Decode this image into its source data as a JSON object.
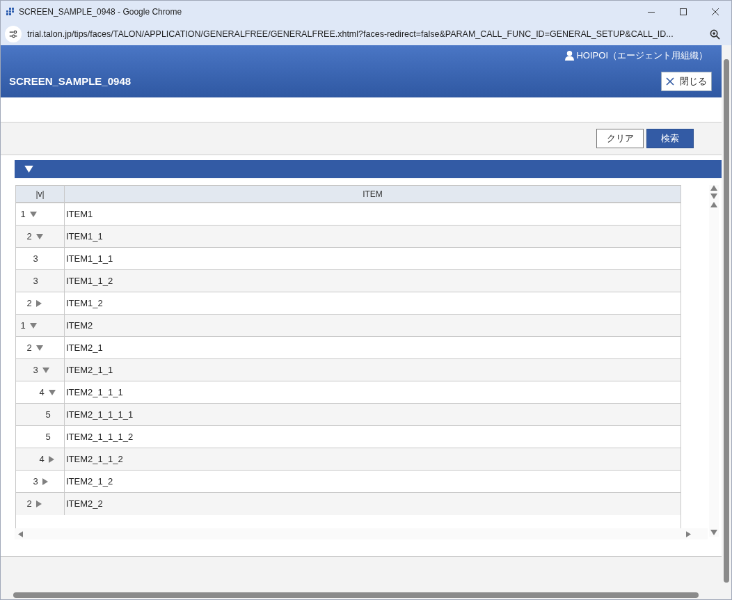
{
  "browser": {
    "title": "SCREEN_SAMPLE_0948 - Google Chrome",
    "url": "trial.talon.jp/tips/faces/TALON/APPLICATION/GENERALFREE/GENERALFREE.xhtml?faces-redirect=false&PARAM_CALL_FUNC_ID=GENERAL_SETUP&CALL_ID..."
  },
  "header": {
    "user": "HOIPOI（エージェント用組織）",
    "title": "SCREEN_SAMPLE_0948",
    "close_button": "閉じる"
  },
  "toolbar": {
    "buttons": [
      {
        "label": "クリア",
        "kind": "secondary"
      },
      {
        "label": "検索",
        "kind": "primary"
      }
    ]
  },
  "section": {
    "expanded": true
  },
  "table": {
    "columns": [
      "|v|",
      "ITEM"
    ],
    "rows": [
      {
        "level": "1",
        "label": "ITEM1",
        "expanded": true,
        "children": [
          {
            "level": "2",
            "label": "ITEM1_1",
            "expanded": true,
            "children": [
              {
                "level": "3",
                "label": "ITEM1_1_1"
              },
              {
                "level": "3",
                "label": "ITEM1_1_2"
              }
            ]
          },
          {
            "level": "2",
            "label": "ITEM1_2",
            "expanded": false
          }
        ]
      },
      {
        "level": "1",
        "label": "ITEM2",
        "expanded": true,
        "children": [
          {
            "level": "2",
            "label": "ITEM2_1",
            "expanded": true,
            "children": [
              {
                "level": "3",
                "label": "ITEM2_1_1",
                "expanded": true,
                "children": [
                  {
                    "level": "4",
                    "label": "ITEM2_1_1_1",
                    "expanded": true,
                    "children": [
                      {
                        "level": "5",
                        "label": "ITEM2_1_1_1_1"
                      },
                      {
                        "level": "5",
                        "label": "ITEM2_1_1_1_2"
                      }
                    ]
                  },
                  {
                    "level": "4",
                    "label": "ITEM2_1_1_2",
                    "expanded": false
                  }
                ]
              },
              {
                "level": "3",
                "label": "ITEM2_1_2",
                "expanded": false
              }
            ]
          },
          {
            "level": "2",
            "label": "ITEM2_2",
            "expanded": false
          }
        ]
      }
    ]
  }
}
